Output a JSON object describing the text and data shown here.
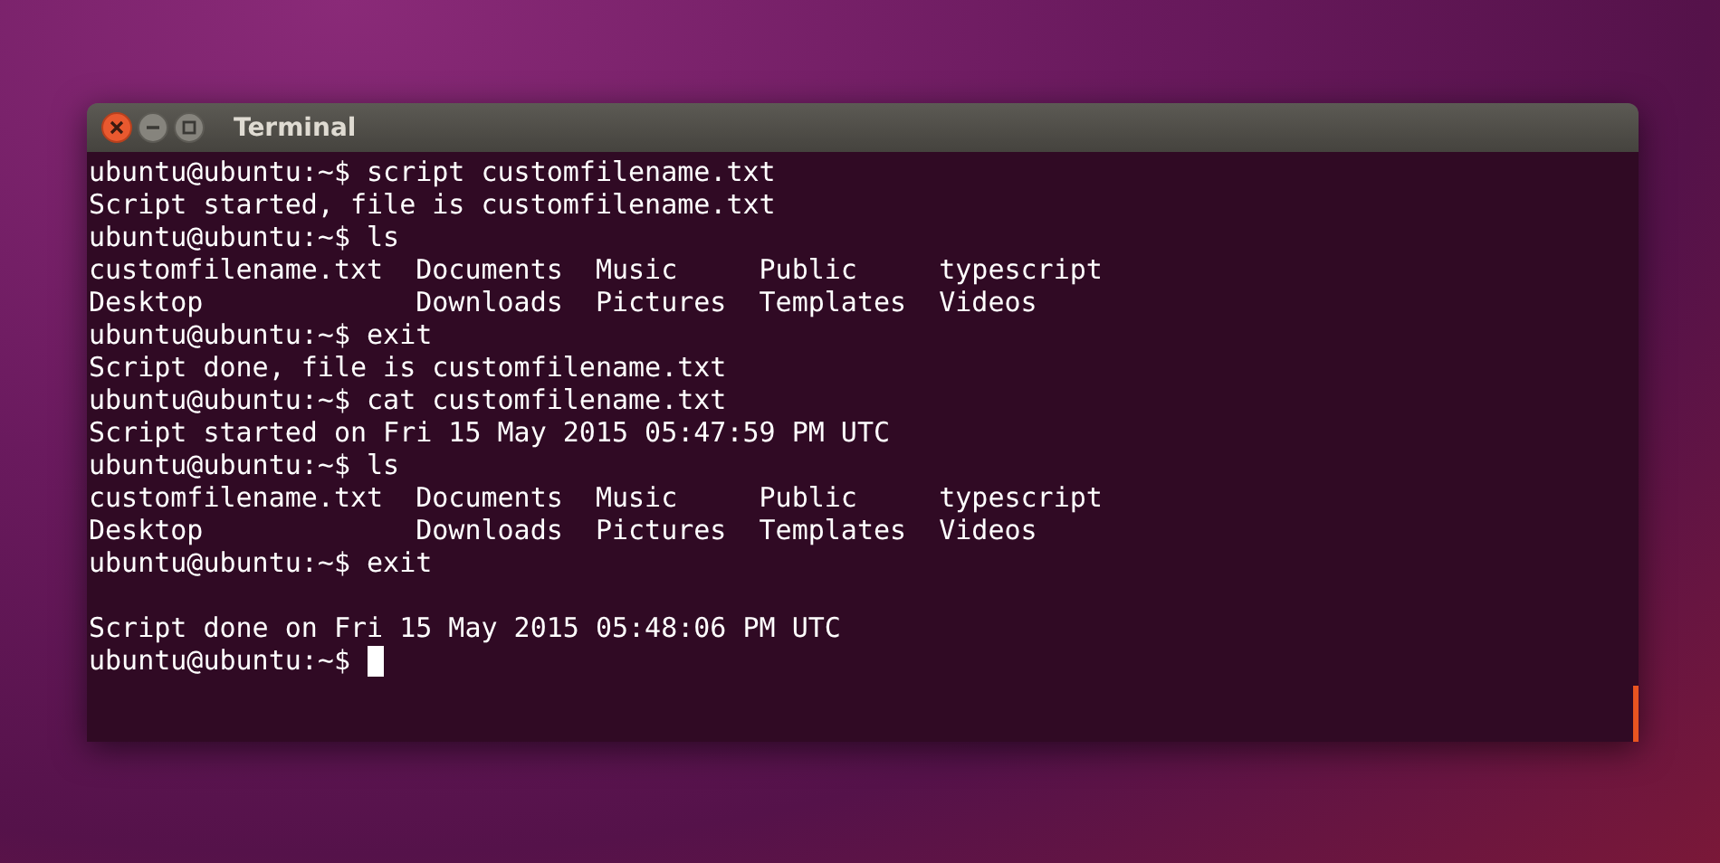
{
  "window": {
    "title": "Terminal"
  },
  "terminal": {
    "lines": [
      {
        "text": "ubuntu@ubuntu:~$ script customfilename.txt",
        "blank_before": false,
        "cursor": false
      },
      {
        "text": "Script started, file is customfilename.txt",
        "blank_before": false,
        "cursor": false
      },
      {
        "text": "ubuntu@ubuntu:~$ ls",
        "blank_before": false,
        "cursor": false
      },
      {
        "text": "customfilename.txt  Documents  Music     Public     typescript",
        "blank_before": false,
        "cursor": false
      },
      {
        "text": "Desktop             Downloads  Pictures  Templates  Videos",
        "blank_before": false,
        "cursor": false
      },
      {
        "text": "ubuntu@ubuntu:~$ exit",
        "blank_before": false,
        "cursor": false
      },
      {
        "text": "Script done, file is customfilename.txt",
        "blank_before": false,
        "cursor": false
      },
      {
        "text": "ubuntu@ubuntu:~$ cat customfilename.txt",
        "blank_before": false,
        "cursor": false
      },
      {
        "text": "Script started on Fri 15 May 2015 05:47:59 PM UTC",
        "blank_before": false,
        "cursor": false
      },
      {
        "text": "ubuntu@ubuntu:~$ ls",
        "blank_before": false,
        "cursor": false
      },
      {
        "text": "customfilename.txt  Documents  Music     Public     typescript",
        "blank_before": false,
        "cursor": false
      },
      {
        "text": "Desktop             Downloads  Pictures  Templates  Videos",
        "blank_before": false,
        "cursor": false
      },
      {
        "text": "ubuntu@ubuntu:~$ exit",
        "blank_before": false,
        "cursor": false
      },
      {
        "text": "Script done on Fri 15 May 2015 05:48:06 PM UTC",
        "blank_before": true,
        "cursor": false
      },
      {
        "text": "ubuntu@ubuntu:~$",
        "blank_before": false,
        "cursor": true
      }
    ]
  }
}
